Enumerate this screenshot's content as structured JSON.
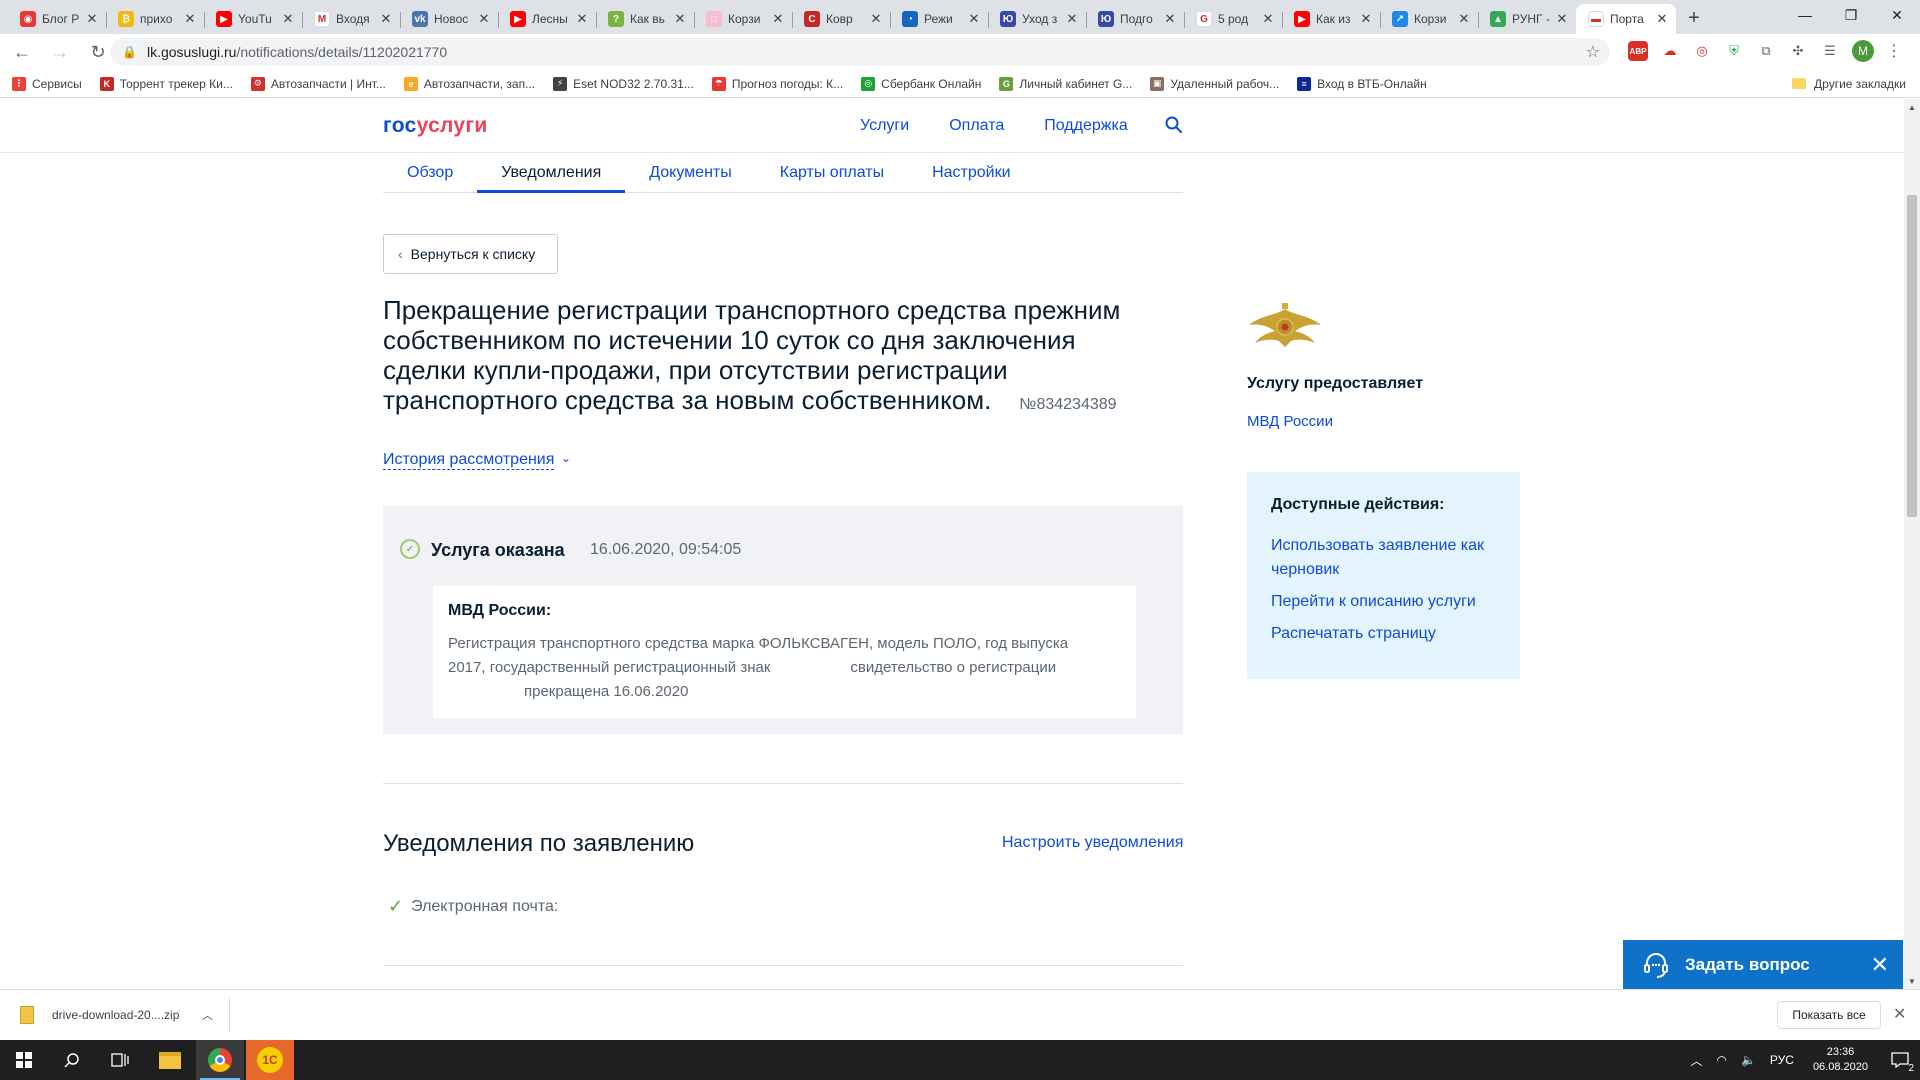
{
  "browser": {
    "tabs": [
      {
        "title": "Блог Р",
        "fav_bg": "#e53935",
        "fav_glyph": "◉"
      },
      {
        "title": "прихо",
        "fav_bg": "#f0b90b",
        "fav_glyph": "₿"
      },
      {
        "title": "YouTu",
        "fav_bg": "#ff0000",
        "fav_glyph": "▶"
      },
      {
        "title": "Входя",
        "fav_bg": "#ffffff",
        "fav_glyph": "M"
      },
      {
        "title": "Новос",
        "fav_bg": "#4a76a8",
        "fav_glyph": "vk"
      },
      {
        "title": "Лесны",
        "fav_bg": "#ff0000",
        "fav_glyph": "▶"
      },
      {
        "title": "Как вь",
        "fav_bg": "#7cb342",
        "fav_glyph": "?"
      },
      {
        "title": "Корзи",
        "fav_bg": "#f8bbd0",
        "fav_glyph": "□"
      },
      {
        "title": "Ковр",
        "fav_bg": "#c62828",
        "fav_glyph": "C"
      },
      {
        "title": "Режи",
        "fav_bg": "#1565c0",
        "fav_glyph": "◔"
      },
      {
        "title": "Уход з",
        "fav_bg": "#3949ab",
        "fav_glyph": "Ю"
      },
      {
        "title": "Подго",
        "fav_bg": "#3949ab",
        "fav_glyph": "Ю"
      },
      {
        "title": "5 род",
        "fav_bg": "#ffffff",
        "fav_glyph": "G"
      },
      {
        "title": "Как из",
        "fav_bg": "#ff0000",
        "fav_glyph": "▶"
      },
      {
        "title": "Корзи",
        "fav_bg": "#1e88e5",
        "fav_glyph": "↗"
      },
      {
        "title": "РУНГ -",
        "fav_bg": "#34a853",
        "fav_glyph": "▲"
      },
      {
        "title": "Порта",
        "fav_bg": "#ffffff",
        "fav_glyph": "▬",
        "active": true
      }
    ],
    "url_host": "lk.gosuslugi.ru",
    "url_path": "/notifications/details/11202021770",
    "avatar_letter": "M",
    "bookmarks": [
      {
        "label": "Сервисы",
        "bg": "#ea4335",
        "glyph": "⋮"
      },
      {
        "label": "Торрент трекер Ки...",
        "bg": "#c62828",
        "glyph": "K"
      },
      {
        "label": "Автозапчасти | Инт...",
        "bg": "#d32f2f",
        "glyph": "⚙"
      },
      {
        "label": "Автозапчасти, зап...",
        "bg": "#f9a825",
        "glyph": "e"
      },
      {
        "label": "Eset NOD32 2.70.31...",
        "bg": "#424242",
        "glyph": "⚡"
      },
      {
        "label": "Прогноз погоды: К...",
        "bg": "#e53935",
        "glyph": "☂"
      },
      {
        "label": "Сбербанк Онлайн",
        "bg": "#21a038",
        "glyph": "◎"
      },
      {
        "label": "Личный кабинет G...",
        "bg": "#689f38",
        "glyph": "G"
      },
      {
        "label": "Удаленный рабоч...",
        "bg": "#8d6e63",
        "glyph": "▣"
      },
      {
        "label": "Вход в ВТБ-Онлайн",
        "bg": "#0a2896",
        "glyph": "≡"
      }
    ],
    "other_bookmarks": "Другие закладки"
  },
  "site": {
    "logo_gos": "гос",
    "logo_uslugi": "услуги",
    "topnav": [
      "Услуги",
      "Оплата",
      "Поддержка"
    ],
    "subnav": [
      {
        "label": "Обзор",
        "active": false
      },
      {
        "label": "Уведомления",
        "active": true
      },
      {
        "label": "Документы",
        "active": false
      },
      {
        "label": "Карты оплаты",
        "active": false
      },
      {
        "label": "Настройки",
        "active": false
      }
    ]
  },
  "notification": {
    "back_label": "Вернуться к списку",
    "title_lines": [
      "Прекращение регистрации транспортного средства прежним",
      "собственником по истечении 10 суток со дня заключения",
      "сделки купли-продажи, при отсутствии регистрации",
      "транспортного средства за новым собственником."
    ],
    "number": "№834234389",
    "history_label": "История рассмотрения",
    "status_label": "Услуга оказана",
    "status_date": "16.06.2020, 09:54:05",
    "message_from": "МВД России:",
    "message_line1": "Регистрация транспортного средства марка ФОЛЬКСВАГЕН, модель ПОЛО, год выпуска",
    "message_line2a": "2017, государственный регистрационный знак",
    "message_line2b": "свидетельство о регистрации",
    "message_line3": "прекращена 16.06.2020",
    "notifications_title": "Уведомления по заявлению",
    "notifications_link": "Настроить уведомления",
    "email_label": "Электронная почта:"
  },
  "sidebar": {
    "provider_label": "Услугу предоставляет",
    "provider_name": "МВД России",
    "actions_title": "Доступные действия:",
    "actions": [
      "Использовать заявление как черновик",
      "Перейти к описанию услуги",
      "Распечатать страницу"
    ]
  },
  "chat": {
    "label": "Задать вопрос"
  },
  "downloads": {
    "file": "drive-download-20....zip",
    "show_all": "Показать все"
  },
  "taskbar": {
    "lang": "РУС",
    "time": "23:36",
    "date": "06.08.2020",
    "notif_count": "2"
  },
  "colors": {
    "brand_blue": "#0d4cd3",
    "brand_red": "#ee3f58",
    "chat_blue": "#0d72c8",
    "actions_bg": "#e4f4fc"
  }
}
